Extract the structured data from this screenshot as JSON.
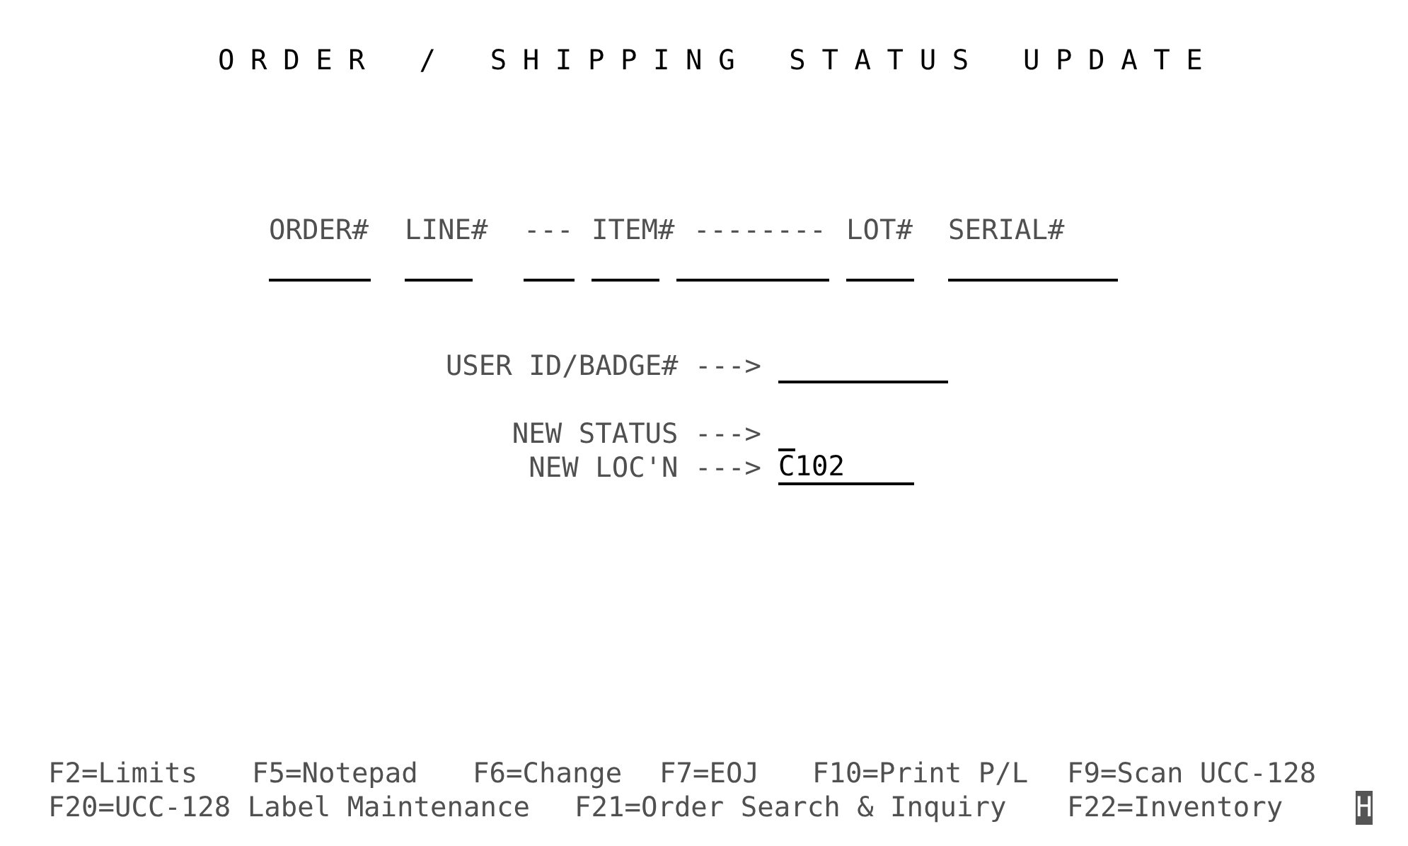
{
  "title": "ORDER / SHIPPING STATUS UPDATE",
  "columns": [
    {
      "header": "ORDER#"
    },
    {
      "header": "LINE#"
    },
    {
      "header": "---"
    },
    {
      "header": "ITEM#"
    },
    {
      "header": "--------"
    },
    {
      "header": "LOT#"
    },
    {
      "header": "SERIAL#"
    }
  ],
  "form": [
    {
      "label": "USER ID/BADGE# --->"
    },
    {
      "label": "NEW STATUS --->"
    },
    {
      "label": "NEW LOC'N --->",
      "value": "C102"
    }
  ],
  "function_key_rows": [
    {
      "keys": [
        "F2=Limits",
        "F5=Notepad",
        "F6=Change",
        "F7=EOJ",
        "F10=Print P/L",
        "F9=Scan UCC-128"
      ]
    },
    {
      "keys": [
        "F20=UCC-128 Label Maintenance",
        "F21=Order Search & Inquiry",
        "F22=Inventory"
      ]
    }
  ],
  "cursor": "H"
}
